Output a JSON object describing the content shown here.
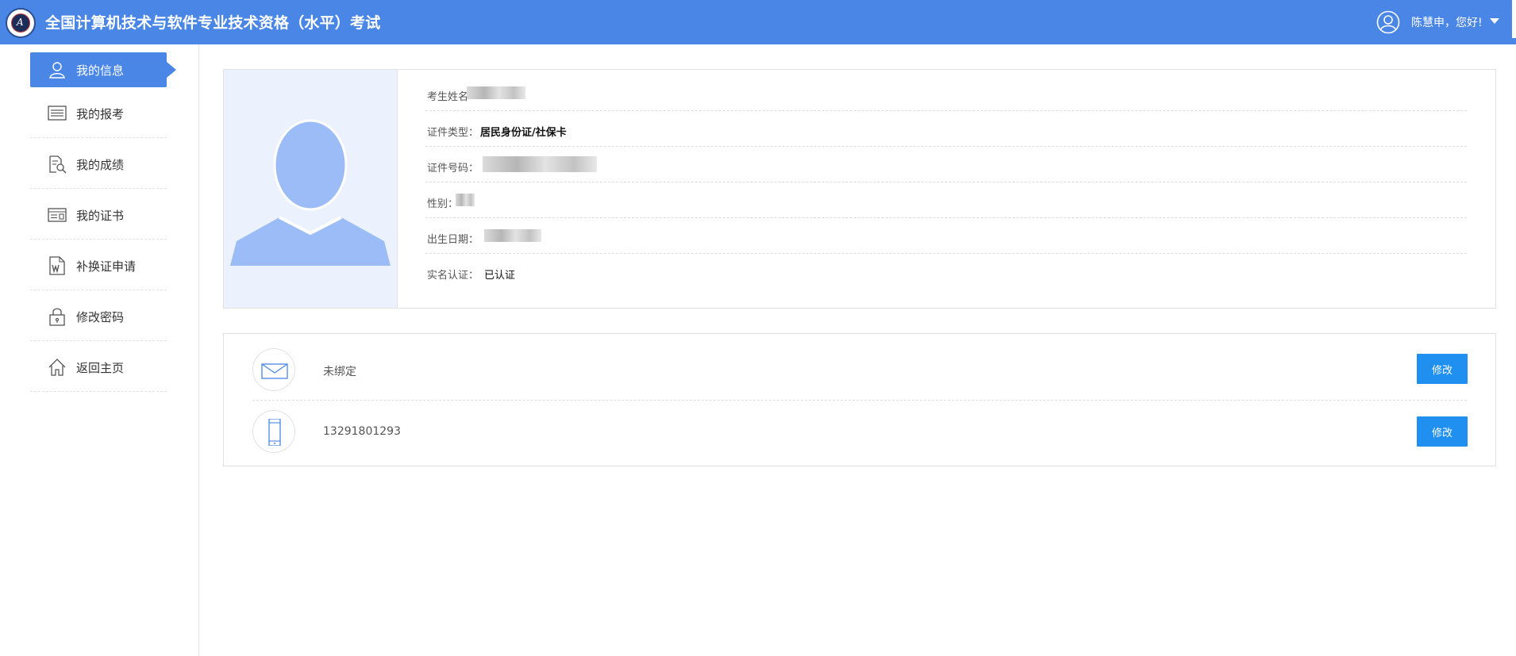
{
  "header": {
    "logo_text": "A",
    "title": "全国计算机技术与软件专业技术资格（水平）考试",
    "user_greeting": "陈慧申，您好!"
  },
  "sidebar": {
    "items": [
      {
        "label": "我的信息",
        "icon": "user-icon",
        "active": true
      },
      {
        "label": "我的报考",
        "icon": "list-icon"
      },
      {
        "label": "我的成绩",
        "icon": "report-search-icon"
      },
      {
        "label": "我的证书",
        "icon": "certificate-icon"
      },
      {
        "label": "补换证申请",
        "icon": "word-document-icon"
      },
      {
        "label": "修改密码",
        "icon": "lock-icon"
      },
      {
        "label": "返回主页",
        "icon": "home-icon"
      }
    ]
  },
  "profile": {
    "fields": [
      {
        "key": "考生姓名",
        "value": ""
      },
      {
        "key": "证件类型：",
        "value": "居民身份证/社保卡"
      },
      {
        "key": "证件号码：",
        "value": ""
      },
      {
        "key": "性别：",
        "value": ""
      },
      {
        "key": "出生日期：",
        "value": ""
      },
      {
        "key": "实名认证：",
        "value": "已认证"
      }
    ]
  },
  "contacts": {
    "email": {
      "value": "未绑定",
      "button": "修改",
      "icon": "envelope-icon"
    },
    "phone": {
      "value": "13291801293",
      "button": "修改",
      "icon": "mobile-phone-icon"
    }
  },
  "colors": {
    "header_bg": "#4a86e5",
    "active_nav": "#4a86e5",
    "button_bg": "#1f8ff0",
    "avatar_fill": "#9bbcf7",
    "photo_bg": "#ebf2fd"
  }
}
